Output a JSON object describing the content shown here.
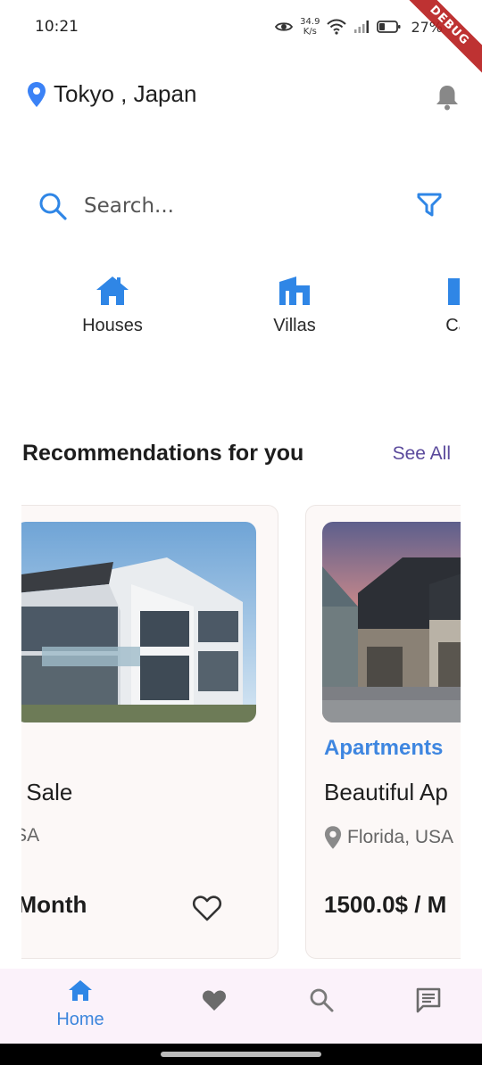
{
  "status_bar": {
    "time": "10:21",
    "net_speed_value": "34.9",
    "net_speed_unit": "K/s",
    "battery": "27%"
  },
  "debug_banner": "DEBUG",
  "header": {
    "location": "Tokyo , Japan",
    "location_icon": "map-pin-icon",
    "bell_icon": "bell-icon"
  },
  "search": {
    "placeholder": "Search...",
    "filter_icon": "filter-icon"
  },
  "categories": [
    {
      "label": "Houses",
      "icon": "house-icon"
    },
    {
      "label": "Villas",
      "icon": "villa-icon"
    },
    {
      "label": "Ca",
      "icon": "building-icon"
    }
  ],
  "recommendations": {
    "title": "Recommendations for you",
    "see_all": "See All",
    "cards": [
      {
        "category": "",
        "title": "or Sale",
        "location": "USA",
        "price": "/ Month"
      },
      {
        "category": "Apartments",
        "title": "Beautiful Ap",
        "location": "Florida, USA",
        "price": "1500.0$ / M"
      }
    ]
  },
  "bottom_nav": {
    "items": [
      {
        "label": "Home",
        "icon": "home-icon",
        "active": true
      },
      {
        "label": "",
        "icon": "heart-icon",
        "active": false
      },
      {
        "label": "",
        "icon": "search-icon",
        "active": false
      },
      {
        "label": "",
        "icon": "chat-icon",
        "active": false
      }
    ]
  },
  "colors": {
    "accent": "#2f86e6",
    "see_all": "#5b4a9c",
    "nav_bg": "#fbf2fa",
    "card_bg": "#fcf8f7"
  }
}
